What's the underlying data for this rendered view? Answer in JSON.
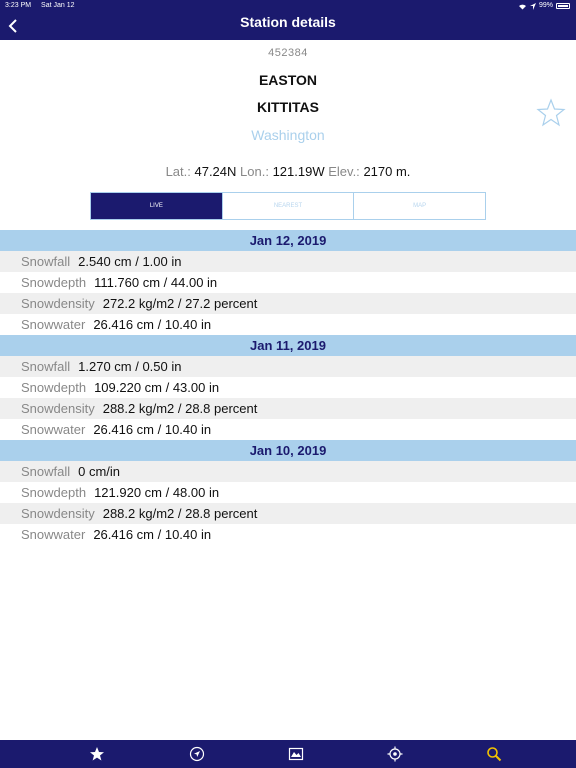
{
  "status_bar": {
    "time": "3:23 PM",
    "date": "Sat Jan 12",
    "battery": "99%"
  },
  "nav": {
    "title": "Station details"
  },
  "station": {
    "id": "452384",
    "name": "EASTON",
    "county": "KITTITAS",
    "state": "Washington"
  },
  "coords": {
    "lat_label": "Lat.:",
    "lat": "47.24N",
    "lon_label": "Lon.:",
    "lon": "121.19W",
    "elev_label": "Elev.:",
    "elev": "2170 m."
  },
  "tabs": [
    "LIVE",
    "NEAREST",
    "MAP"
  ],
  "days": [
    {
      "date": "Jan 12, 2019",
      "rows": [
        {
          "k": "Snowfall",
          "v": "2.540 cm / 1.00 in"
        },
        {
          "k": "Snowdepth",
          "v": "111.760 cm / 44.00 in"
        },
        {
          "k": "Snowdensity",
          "v": "272.2 kg/m2 / 27.2 percent"
        },
        {
          "k": "Snowwater",
          "v": "26.416 cm / 10.40 in"
        }
      ]
    },
    {
      "date": "Jan 11, 2019",
      "rows": [
        {
          "k": "Snowfall",
          "v": "1.270 cm / 0.50 in"
        },
        {
          "k": "Snowdepth",
          "v": "109.220 cm / 43.00 in"
        },
        {
          "k": "Snowdensity",
          "v": "288.2 kg/m2 / 28.8 percent"
        },
        {
          "k": "Snowwater",
          "v": "26.416 cm / 10.40 in"
        }
      ]
    },
    {
      "date": "Jan 10, 2019",
      "rows": [
        {
          "k": "Snowfall",
          "v": "0 cm/in"
        },
        {
          "k": "Snowdepth",
          "v": "121.920 cm / 48.00 in"
        },
        {
          "k": "Snowdensity",
          "v": "288.2 kg/m2 / 28.8 percent"
        },
        {
          "k": "Snowwater",
          "v": "26.416 cm / 10.40 in"
        }
      ]
    }
  ],
  "tabbar": [
    "star-icon",
    "location-arrow-icon",
    "map-icon",
    "crosshair-icon",
    "search-icon"
  ],
  "colors": {
    "navy": "#1b1a6e",
    "light_blue": "#aad0ec",
    "gold": "#f2c200"
  }
}
